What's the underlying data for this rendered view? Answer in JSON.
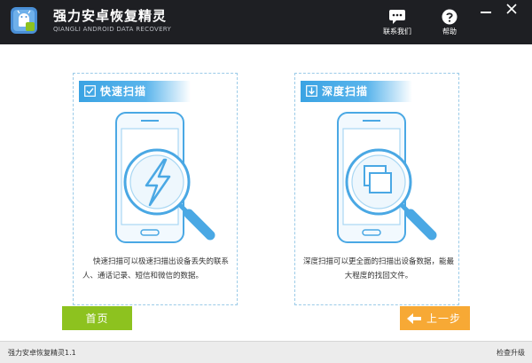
{
  "header": {
    "title": "强力安卓恢复精灵",
    "subtitle": "QIANGLI ANDROID DATA RECOVERY",
    "contact_label": "联系我们",
    "help_label": "帮助"
  },
  "panels": [
    {
      "title": "快速扫描",
      "description": "快速扫描可以极速扫描出设备丢失的联系人、通话记录、短信和微信的数据。",
      "icon": "lightning-icon"
    },
    {
      "title": "深度扫描",
      "description": "深度扫描可以更全面的扫描出设备数据，能最大程度的找回文件。",
      "icon": "stacked-squares-icon"
    }
  ],
  "footer": {
    "home_label": "首页",
    "back_label": "上一步"
  },
  "status": {
    "version": "强力安卓恢复精灵1.1",
    "update": "检查升级"
  },
  "colors": {
    "titlebar": "#1e1f23",
    "accent_blue": "#3aa3e3",
    "home_green": "#8dc21f",
    "back_orange": "#f7a935"
  }
}
